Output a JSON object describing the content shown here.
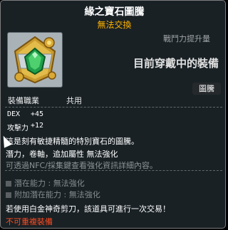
{
  "item": {
    "name": "緣之寶石圖騰",
    "trade_status": "無法交換",
    "power_label": "戰鬥力提升量",
    "equipped_title": "目前穿戴中的裝備",
    "icon": "emerald-totem-icon",
    "job_label": "裝備職業",
    "job_value": "共用",
    "category": "圖騰"
  },
  "stats": [
    {
      "name": "DEX",
      "value": "+45"
    },
    {
      "name": "攻擊力",
      "value": "+12"
    }
  ],
  "description": "這是刻有敏捷精髓的特別寶石的圖騰。",
  "upgrades": "潛力，卷軸，追加屬性 無法強化",
  "info_line": "可透過NFC/採集鍵查看強化資訊詳細內容。",
  "potentials": [
    {
      "label": "潛在能力 : 無法強化"
    },
    {
      "label": "附加潛在能力 : 無法強化"
    }
  ],
  "scissors_note": "若使用白金神奇剪刀，該道具可進行一次交易！",
  "reequip_note": "不可重複裝備",
  "colors": {
    "background": "#1a2226",
    "trade_status": "#ffb300",
    "warning": "#ff4a1f",
    "muted": "#868c8f"
  }
}
